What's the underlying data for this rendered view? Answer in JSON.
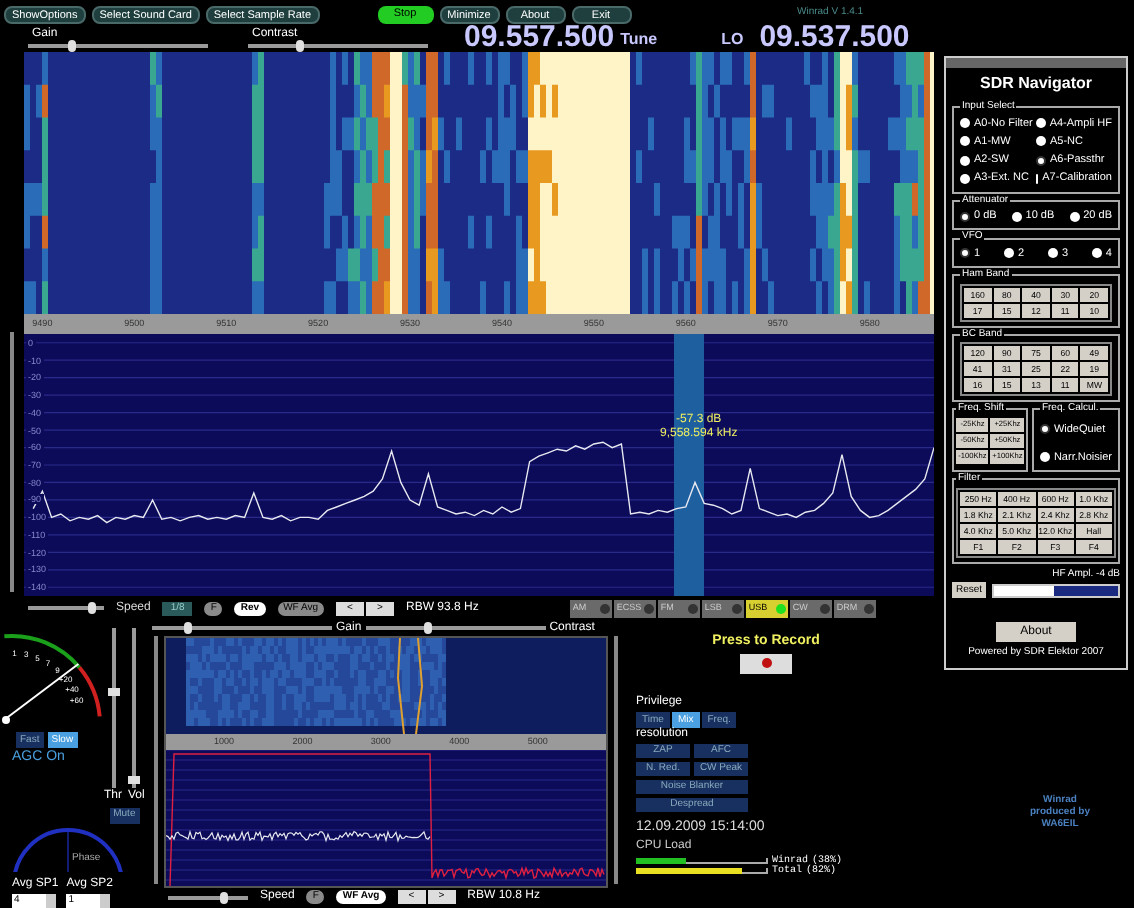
{
  "toolbar": {
    "buttons": [
      {
        "label": "ShowOptions",
        "kind": "normal"
      },
      {
        "label": "Select Sound Card",
        "kind": "normal"
      },
      {
        "label": "Select Sample Rate",
        "kind": "normal"
      },
      {
        "label": "Stop",
        "kind": "active"
      },
      {
        "label": "Minimize",
        "kind": "normal"
      },
      {
        "label": "About",
        "kind": "normal"
      },
      {
        "label": "Exit",
        "kind": "normal"
      }
    ],
    "version": "Winrad V 1.4.1"
  },
  "main_sliders": [
    {
      "label": "Gain",
      "level": 0.24
    },
    {
      "label": "Contrast",
      "level": 0.29
    }
  ],
  "tune": {
    "frequency": "09.557.500",
    "label": "Tune"
  },
  "lo": {
    "label": "LO",
    "frequency": "09.537.500"
  },
  "spectrum": {
    "chart_data": {
      "type": "line",
      "xlim": [
        9488,
        9587
      ],
      "ylim": [
        -145,
        5
      ],
      "grid": true,
      "xticks": [
        9490,
        9500,
        9510,
        9520,
        9530,
        9540,
        9550,
        9560,
        9570,
        9580
      ],
      "yticks": [
        0,
        -10,
        -20,
        -30,
        -40,
        -50,
        -60,
        -70,
        -80,
        -90,
        -100,
        -110,
        -120,
        -130,
        -140
      ],
      "x": [
        9489,
        9490,
        9491,
        9492,
        9493,
        9494,
        9495,
        9496,
        9497,
        9498,
        9499,
        9500,
        9501,
        9502,
        9503,
        9504,
        9505,
        9506,
        9507,
        9508,
        9509,
        9510,
        9511,
        9512,
        9513,
        9514,
        9515,
        9516,
        9517,
        9518,
        9519,
        9520,
        9521,
        9522,
        9523,
        9524,
        9525,
        9526,
        9527,
        9528,
        9529,
        9530,
        9531,
        9532,
        9533,
        9534,
        9535,
        9536,
        9537,
        9538,
        9539,
        9540,
        9541,
        9542,
        9543,
        9544,
        9545,
        9546,
        9547,
        9548,
        9549,
        9550,
        9551,
        9552,
        9553,
        9554,
        9555,
        9556,
        9557,
        9558,
        9559,
        9560,
        9561,
        9562,
        9563,
        9564,
        9565,
        9566,
        9567,
        9568,
        9569,
        9570,
        9571,
        9572,
        9573,
        9574,
        9575,
        9576,
        9577,
        9578,
        9579,
        9580,
        9581,
        9582,
        9583,
        9584,
        9585,
        9586,
        9587
      ],
      "series": [
        {
          "color": "#e8e8f0",
          "values": [
            -95,
            -85,
            -100,
            -98,
            -102,
            -100,
            -101,
            -99,
            -103,
            -100,
            -101,
            -99,
            -100,
            -90,
            -101,
            -100,
            -102,
            -100,
            -99,
            -101,
            -100,
            -101,
            -99,
            -100,
            -86,
            -100,
            -101,
            -99,
            -102,
            -100,
            -100,
            -101,
            -96,
            -94,
            -92,
            -90,
            -88,
            -85,
            -78,
            -62,
            -80,
            -90,
            -93,
            -75,
            -94,
            -96,
            -98,
            -97,
            -99,
            -96,
            -98,
            -94,
            -97,
            -95,
            -68,
            -65,
            -63,
            -61,
            -62,
            -59,
            -61,
            -58,
            -57,
            -60,
            -58,
            -98,
            -97,
            -98,
            -96,
            -97,
            -95,
            -94,
            -80,
            -92,
            -93,
            -95,
            -98,
            -96,
            -72,
            -95,
            -97,
            -99,
            -98,
            -100,
            -97,
            -96,
            -92,
            -86,
            -64,
            -88,
            -96,
            -100,
            -99,
            -96,
            -92,
            -88,
            -84,
            -78,
            -60
          ]
        }
      ]
    },
    "marker": {
      "level_text": "-57.3 dB",
      "frequency_text": "9,558.594 kHz"
    }
  },
  "spectrum_controls": {
    "speed": {
      "label": "Speed",
      "level": 0.85
    },
    "rate": "1/8",
    "buttons": [
      {
        "label": "F",
        "selected": false
      },
      {
        "label": "Rev",
        "selected": true
      },
      {
        "label": "WF Avg",
        "selected": false
      }
    ],
    "steps": [
      "<",
      ">"
    ],
    "rbw": "RBW 93.8 Hz"
  },
  "modes": [
    {
      "label": "AM",
      "selected": false
    },
    {
      "label": "ECSS",
      "selected": false
    },
    {
      "label": "FM",
      "selected": false
    },
    {
      "label": "LSB",
      "selected": false
    },
    {
      "label": "USB",
      "selected": true
    },
    {
      "label": "CW",
      "selected": false
    },
    {
      "label": "DRM",
      "selected": false
    }
  ],
  "navigator": {
    "title": "SDR Navigator",
    "input_select": {
      "legend": "Input Select",
      "options": [
        {
          "label": "A0-No Filter",
          "selected": false
        },
        {
          "label": "A4-Ampli HF",
          "selected": false
        },
        {
          "label": "A1-MW",
          "selected": false
        },
        {
          "label": "A5-NC",
          "selected": false
        },
        {
          "label": "A2-SW",
          "selected": false
        },
        {
          "label": "A6-Passthr",
          "selected": true
        },
        {
          "label": "A3-Ext. NC",
          "selected": false
        },
        {
          "label": "A7-Calibration",
          "selected": false
        }
      ]
    },
    "attenuator": {
      "legend": "Attenuator",
      "options": [
        {
          "label": "0 dB",
          "selected": true
        },
        {
          "label": "10 dB",
          "selected": false
        },
        {
          "label": "20 dB",
          "selected": false
        }
      ]
    },
    "vfo": {
      "legend": "VFO",
      "options": [
        {
          "label": "1",
          "selected": true
        },
        {
          "label": "2",
          "selected": false
        },
        {
          "label": "3",
          "selected": false
        },
        {
          "label": "4",
          "selected": false
        }
      ]
    },
    "ham_band": {
      "legend": "Ham Band",
      "buttons": [
        "160",
        "80",
        "40",
        "30",
        "20",
        "17",
        "15",
        "12",
        "11",
        "10"
      ]
    },
    "bc_band": {
      "legend": "BC Band",
      "buttons": [
        "120",
        "90",
        "75",
        "60",
        "49",
        "41",
        "31",
        "25",
        "22",
        "19",
        "16",
        "15",
        "13",
        "11",
        "MW"
      ]
    },
    "freq_shift": {
      "legend": "Freq. Shift",
      "buttons": [
        "-25Khz",
        "+25Khz",
        "-50Khz",
        "+50Khz",
        "-100Khz",
        "+100Khz"
      ]
    },
    "freq_calcul": {
      "legend": "Freq. Calcul.",
      "options": [
        {
          "label": "WideQuiet",
          "selected": true
        },
        {
          "label": "Narr.Noisier",
          "selected": false
        }
      ]
    },
    "filter": {
      "legend": "Filter",
      "buttons": [
        "250 Hz",
        "400 Hz",
        "600 Hz",
        "1.0 Khz",
        "1.8 Khz",
        "2.1 Khz",
        "2.4 Khz",
        "2.8 Khz",
        "4.0 Khz",
        "5.0 Khz",
        "12.0 Khz",
        "Hall",
        "F1",
        "F2",
        "F3",
        "F4"
      ]
    },
    "hf_ampl": {
      "label": "HF Ampl. -4  dB",
      "reset": "Reset",
      "level": 0.48
    },
    "about": "About",
    "powered": "Powered by SDR Elektor 2007"
  },
  "smeter": {
    "scale": [
      "1",
      "3",
      "5",
      "7",
      "9",
      "+20",
      "+40",
      "+60"
    ],
    "level": 0.7
  },
  "agc": {
    "speeds": [
      {
        "label": "Fast",
        "selected": false
      },
      {
        "label": "Slow",
        "selected": true
      }
    ],
    "status": "AGC On"
  },
  "audio_sliders": [
    {
      "label": "Thr",
      "level": 0.6
    },
    {
      "label": "Vol",
      "level": 0.05
    }
  ],
  "mute": "Mute",
  "phase": {
    "label": "Phase"
  },
  "averages": [
    {
      "label": "Avg SP1",
      "value": "4"
    },
    {
      "label": "Avg SP2",
      "value": "1"
    }
  ],
  "audio_display": {
    "sliders": [
      {
        "label": "Gain",
        "level": 0.2
      },
      {
        "label": "Contrast",
        "level": 0.35
      }
    ],
    "freq_labels": [
      "1000",
      "2000",
      "3000",
      "4000",
      "5000"
    ],
    "speed": {
      "label": "Speed",
      "level": 0.7
    },
    "buttons": [
      {
        "label": "F",
        "selected": false
      },
      {
        "label": "WF Avg",
        "selected": true
      }
    ],
    "steps": [
      "<",
      ">"
    ],
    "rbw": "RBW 10.8 Hz"
  },
  "record": {
    "label": "Press to Record"
  },
  "privilege": {
    "label": "Privilege",
    "options": [
      {
        "label": "Time",
        "selected": false
      },
      {
        "label": "Mix",
        "selected": true
      },
      {
        "label": "Freq.",
        "selected": false
      }
    ],
    "sublabel": "resolution"
  },
  "dsp_buttons": [
    "ZAP",
    "AFC",
    "N. Red.",
    "CW Peak",
    "Noise Blanker",
    "Despread"
  ],
  "datetime": "12.09.2009 15:14:00",
  "cpu": {
    "label": "CPU Load",
    "bars": [
      {
        "name": "Winrad",
        "reading": "(38%)",
        "level": 0.38,
        "color": "#22c022"
      },
      {
        "name": "Total",
        "reading": "(82%)",
        "level": 0.82,
        "color": "#e8e020"
      }
    ]
  },
  "credits": "Winrad produced by WA6EIL"
}
